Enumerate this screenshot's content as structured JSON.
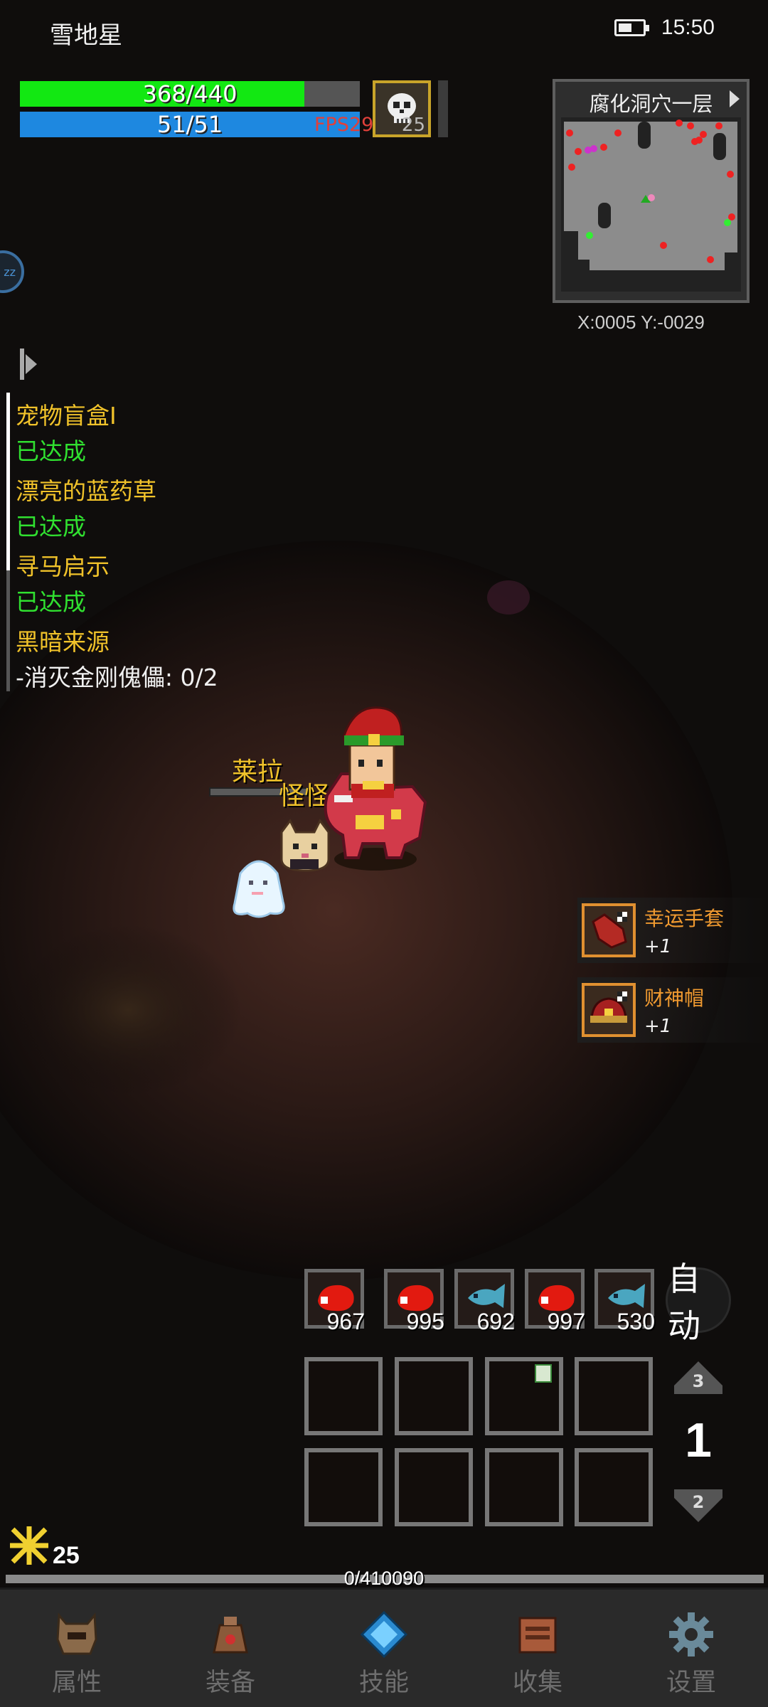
{
  "status_bar": {
    "app_name": "雪地星",
    "time": "15:50"
  },
  "player": {
    "hp": {
      "text": "368/440",
      "current": 368,
      "max": 440
    },
    "mp": {
      "text": "51/51",
      "current": 51,
      "max": 51
    },
    "fps": "FPS29",
    "skull_level": "25"
  },
  "minimap": {
    "title": "腐化洞穴一层",
    "coords": "X:0005  Y:-0029"
  },
  "sleep_button": "zz",
  "quests": [
    {
      "title": "宠物盲盒I",
      "status": "已达成"
    },
    {
      "title": "漂亮的蓝药草",
      "status": "已达成"
    },
    {
      "title": "寻马启示",
      "status": "已达成"
    },
    {
      "title": "黑暗来源",
      "task": "-消灭金刚傀儡: 0/2"
    }
  ],
  "scene": {
    "npc_name": "莱拉",
    "pet_name": "怪怪"
  },
  "drops": [
    {
      "name": "幸运手套",
      "count": "+1",
      "icon": "glove-icon"
    },
    {
      "name": "财神帽",
      "count": "+1",
      "icon": "hat-icon"
    }
  ],
  "quick_bar": {
    "slots": [
      {
        "qty": "967",
        "icon": "red-meat-icon"
      },
      {
        "qty": "995",
        "icon": "red-meat-icon"
      },
      {
        "qty": "692",
        "icon": "blue-fish-icon"
      },
      {
        "qty": "997",
        "icon": "red-meat-icon"
      },
      {
        "qty": "530",
        "icon": "blue-fish-icon"
      }
    ],
    "auto_label": "自动"
  },
  "inventory": {
    "page": "1",
    "page_up": "3",
    "page_down": "2"
  },
  "exp": {
    "gems": "25",
    "text": "0/410090",
    "fraction": 0.0
  },
  "nav": [
    {
      "label": "属性",
      "icon": "helmet-icon"
    },
    {
      "label": "装备",
      "icon": "bag-icon"
    },
    {
      "label": "技能",
      "icon": "skill-gem-icon"
    },
    {
      "label": "收集",
      "icon": "book-icon"
    },
    {
      "label": "设置",
      "icon": "gear-icon"
    }
  ],
  "colors": {
    "hp": "#12e812",
    "mp": "#1e88e0",
    "quest_title": "#f0c22a",
    "quest_done": "#30e030",
    "drop_name": "#f09a30"
  }
}
